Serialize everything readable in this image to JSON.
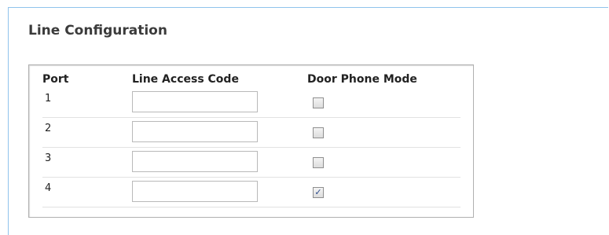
{
  "section": {
    "title": "Line Configuration"
  },
  "table": {
    "headers": {
      "port": "Port",
      "line_access_code": "Line Access Code",
      "door_phone_mode": "Door Phone Mode"
    },
    "rows": [
      {
        "port": "1",
        "line_access_code": "",
        "door_phone_mode": false
      },
      {
        "port": "2",
        "line_access_code": "",
        "door_phone_mode": false
      },
      {
        "port": "3",
        "line_access_code": "",
        "door_phone_mode": false
      },
      {
        "port": "4",
        "line_access_code": "",
        "door_phone_mode": true
      }
    ]
  },
  "icons": {
    "checked": "checkmark-icon"
  },
  "colors": {
    "panel_border": "#8fc3ec",
    "checkmark": "#2b4a8a"
  }
}
